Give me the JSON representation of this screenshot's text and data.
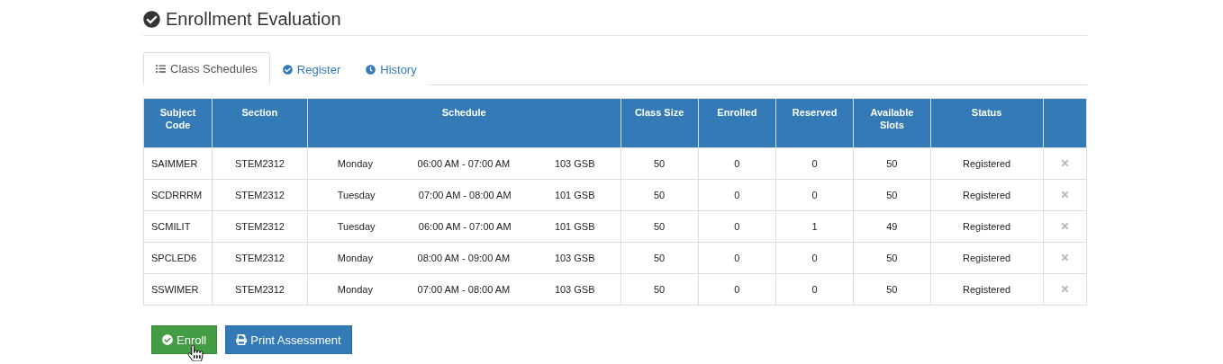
{
  "header": {
    "title": "Enrollment Evaluation"
  },
  "tabs": [
    {
      "label": "Class Schedules",
      "selected": true
    },
    {
      "label": "Register",
      "selected": false
    },
    {
      "label": "History",
      "selected": false
    }
  ],
  "table": {
    "columns": [
      "Subject Code",
      "Section",
      "Schedule",
      "Class Size",
      "Enrolled",
      "Reserved",
      "Available Slots",
      "Status"
    ],
    "rows": [
      {
        "subject_code": "SAIMMER",
        "section": "STEM2312",
        "day": "Monday",
        "time": "06:00 AM - 07:00 AM",
        "room": "103 GSB",
        "class_size": "50",
        "enrolled": "0",
        "reserved": "0",
        "available_slots": "50",
        "status": "Registered"
      },
      {
        "subject_code": "SCDRRRM",
        "section": "STEM2312",
        "day": "Tuesday",
        "time": "07:00 AM - 08:00 AM",
        "room": "101 GSB",
        "class_size": "50",
        "enrolled": "0",
        "reserved": "0",
        "available_slots": "50",
        "status": "Registered"
      },
      {
        "subject_code": "SCMILIT",
        "section": "STEM2312",
        "day": "Tuesday",
        "time": "06:00 AM - 07:00 AM",
        "room": "101 GSB",
        "class_size": "50",
        "enrolled": "0",
        "reserved": "1",
        "available_slots": "49",
        "status": "Registered"
      },
      {
        "subject_code": "SPCLED6",
        "section": "STEM2312",
        "day": "Monday",
        "time": "08:00 AM - 09:00 AM",
        "room": "103 GSB",
        "class_size": "50",
        "enrolled": "0",
        "reserved": "0",
        "available_slots": "50",
        "status": "Registered"
      },
      {
        "subject_code": "SSWIMER",
        "section": "STEM2312",
        "day": "Monday",
        "time": "07:00 AM - 08:00 AM",
        "room": "103 GSB",
        "class_size": "50",
        "enrolled": "0",
        "reserved": "0",
        "available_slots": "50",
        "status": "Registered"
      }
    ]
  },
  "buttons": [
    {
      "label": "Enroll",
      "kind": "success"
    },
    {
      "label": "Print Assessment",
      "kind": "primary"
    }
  ]
}
